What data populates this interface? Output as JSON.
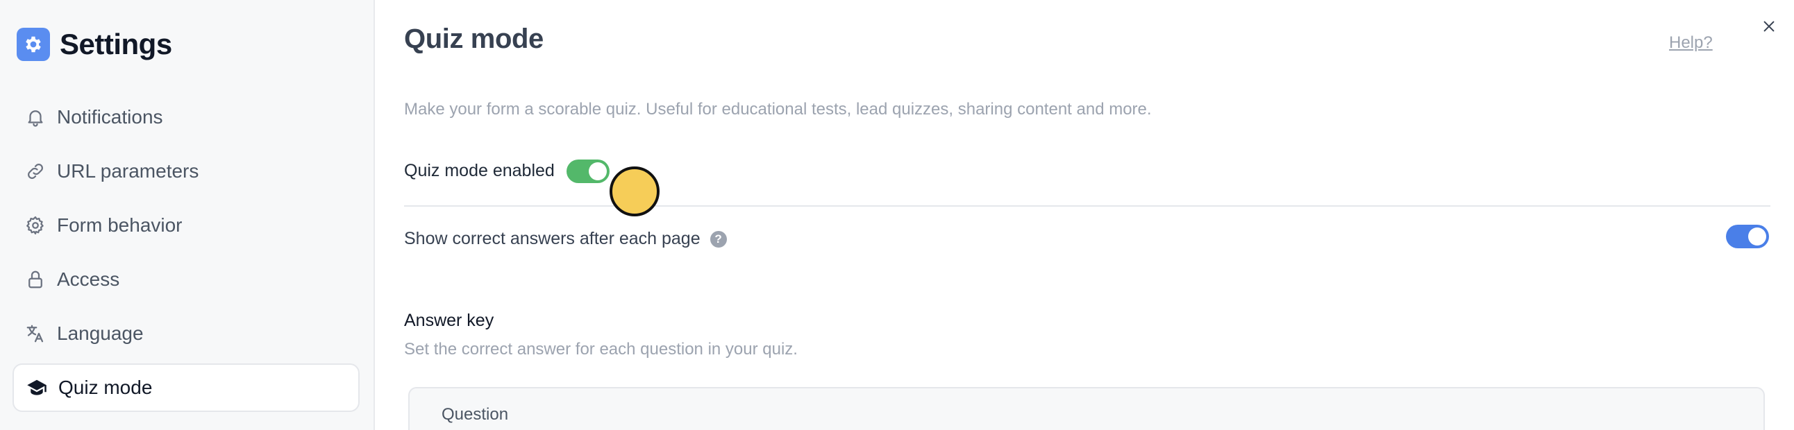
{
  "sidebar": {
    "title": "Settings",
    "items": [
      {
        "label": "Notifications",
        "icon": "bell-icon"
      },
      {
        "label": "URL parameters",
        "icon": "link-icon"
      },
      {
        "label": "Form behavior",
        "icon": "gear-icon"
      },
      {
        "label": "Access",
        "icon": "lock-icon"
      },
      {
        "label": "Language",
        "icon": "translate-icon"
      },
      {
        "label": "Quiz mode",
        "icon": "graduation-cap-icon",
        "active": true
      }
    ]
  },
  "main": {
    "title": "Quiz mode",
    "help_label": "Help?",
    "description": "Make your form a scorable quiz. Useful for educational tests, lead quizzes, sharing content and more.",
    "quiz_enabled": {
      "label": "Quiz mode enabled",
      "on": true,
      "color": "#53b86a"
    },
    "show_correct": {
      "label": "Show correct answers after each page",
      "on": true,
      "color": "#4a7fe8"
    },
    "answer_key": {
      "title": "Answer key",
      "description": "Set the correct answer for each question in your quiz.",
      "column_header": "Question"
    }
  },
  "colors": {
    "accent": "#5a8df0",
    "cursor_marker": "#f6cd58"
  }
}
